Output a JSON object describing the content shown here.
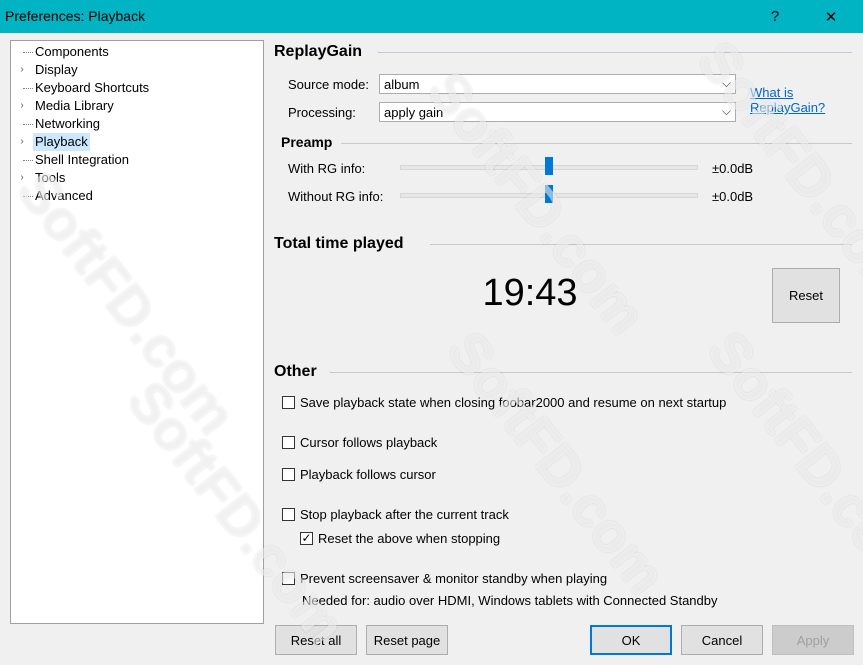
{
  "window": {
    "title": "Preferences: Playback",
    "help": "?",
    "close": "✕"
  },
  "tree": [
    {
      "label": "Components",
      "expandable": false,
      "selected": false
    },
    {
      "label": "Display",
      "expandable": true,
      "selected": false
    },
    {
      "label": "Keyboard Shortcuts",
      "expandable": false,
      "selected": false
    },
    {
      "label": "Media Library",
      "expandable": true,
      "selected": false
    },
    {
      "label": "Networking",
      "expandable": false,
      "selected": false
    },
    {
      "label": "Playback",
      "expandable": true,
      "selected": true
    },
    {
      "label": "Shell Integration",
      "expandable": false,
      "selected": false
    },
    {
      "label": "Tools",
      "expandable": true,
      "selected": false
    },
    {
      "label": "Advanced",
      "expandable": false,
      "selected": false
    }
  ],
  "replaygain": {
    "heading": "ReplayGain",
    "source_mode_label": "Source mode:",
    "source_mode_value": "album",
    "processing_label": "Processing:",
    "processing_value": "apply gain",
    "link": "What is ReplayGain?"
  },
  "preamp": {
    "heading": "Preamp",
    "with_label": "With RG info:",
    "with_value": "±0.0dB",
    "with_level": 0.5,
    "without_label": "Without RG info:",
    "without_value": "±0.0dB",
    "without_level": 0.5
  },
  "total_time": {
    "heading": "Total time played",
    "value": "19:43",
    "reset": "Reset"
  },
  "other": {
    "heading": "Other",
    "options": [
      {
        "label": "Save playback state when closing foobar2000 and resume on next startup",
        "checked": false
      },
      {
        "label": "Cursor follows playback",
        "checked": false
      },
      {
        "label": "Playback follows cursor",
        "checked": false
      },
      {
        "label": "Stop playback after the current track",
        "checked": false
      },
      {
        "label": "Reset the above when stopping",
        "checked": true
      },
      {
        "label": "Prevent screensaver & monitor standby when playing",
        "checked": false
      }
    ],
    "note": "Needed for: audio over HDMI, Windows tablets with Connected Standby"
  },
  "buttons": {
    "reset_all": "Reset all",
    "reset_page": "Reset page",
    "ok": "OK",
    "cancel": "Cancel",
    "apply": "Apply"
  },
  "watermark": "SoftFD.com",
  "icons": {
    "expand": "chevron-right-icon",
    "check": "checkmark-icon"
  },
  "colors": {
    "titlebar": "#00b4c4",
    "accent": "#0078d7",
    "selection": "#cce8ff",
    "link": "#0066cc"
  }
}
